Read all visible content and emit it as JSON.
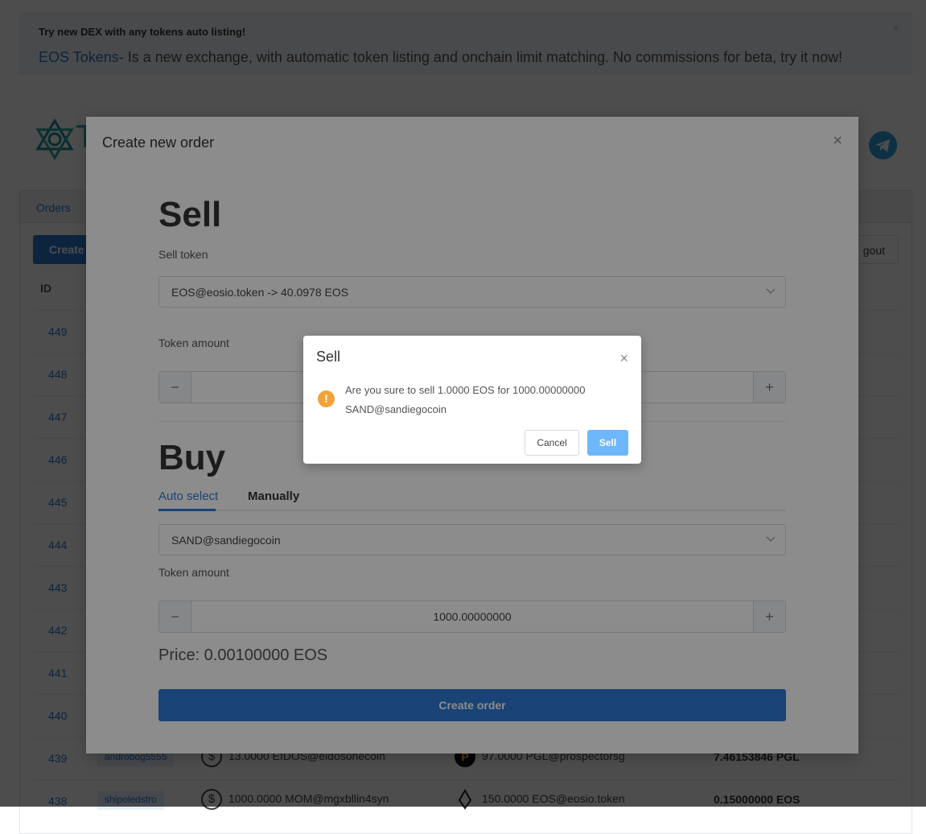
{
  "banner": {
    "title": "Try new DEX with any tokens auto listing!",
    "link": "EOS Tokens",
    "text": "- Is a new exchange, with automatic token listing and onchain limit matching. No commissions for beta, try it now!",
    "close": "×"
  },
  "header": {
    "logo_letter": "T"
  },
  "panel": {
    "tab_orders": "Orders",
    "create_button": "Create",
    "logout_button": "gout",
    "col_id": "ID",
    "rows": [
      {
        "id": "449"
      },
      {
        "id": "448"
      },
      {
        "id": "447"
      },
      {
        "id": "446"
      },
      {
        "id": "445"
      },
      {
        "id": "444"
      },
      {
        "id": "443"
      },
      {
        "id": "442"
      },
      {
        "id": "441"
      },
      {
        "id": "440"
      },
      {
        "id": "439",
        "user": "androbog5555",
        "sell_icon": "$",
        "sell": "13.0000 EIDOS@eidosonecoin",
        "buy_icon": "P",
        "buy": "97.0000 PGL@prospectorsg",
        "price": "7.46153846 PGL"
      },
      {
        "id": "438",
        "user": "shipoledstro",
        "sell_icon": "$",
        "sell": "1000.0000 MOM@mgxbllin4syn",
        "buy_icon": "eos-icon",
        "buy": "150.0000 EOS@eosio.token",
        "price": "0.15000000 EOS"
      }
    ]
  },
  "modal": {
    "title": "Create new order",
    "close": "×",
    "sell_heading": "Sell",
    "sell_token_label": "Sell token",
    "sell_token_value": "EOS@eosio.token ->  40.0978 EOS",
    "sell_amount_label": "Token amount",
    "sell_amount_value": "",
    "buy_heading": "Buy",
    "tab_auto": "Auto select",
    "tab_manual": "Manually",
    "buy_token_value": "SAND@sandiegocoin",
    "buy_amount_label": "Token amount",
    "buy_amount_value": "1000.00000000",
    "minus": "−",
    "plus": "+",
    "price": "Price: 0.00100000 EOS",
    "create_button": "Create order"
  },
  "confirm": {
    "title": "Sell",
    "close": "×",
    "icon": "!",
    "message": "Are you sure to sell 1.0000 EOS for 1000.00000000 SAND@sandiegocoin",
    "cancel": "Cancel",
    "ok": "Sell"
  },
  "colors": {
    "accent": "#2e7bd3",
    "teal": "#2aa7a0",
    "warning": "#f1a33a",
    "confirm_button": "#6eb7fa"
  }
}
